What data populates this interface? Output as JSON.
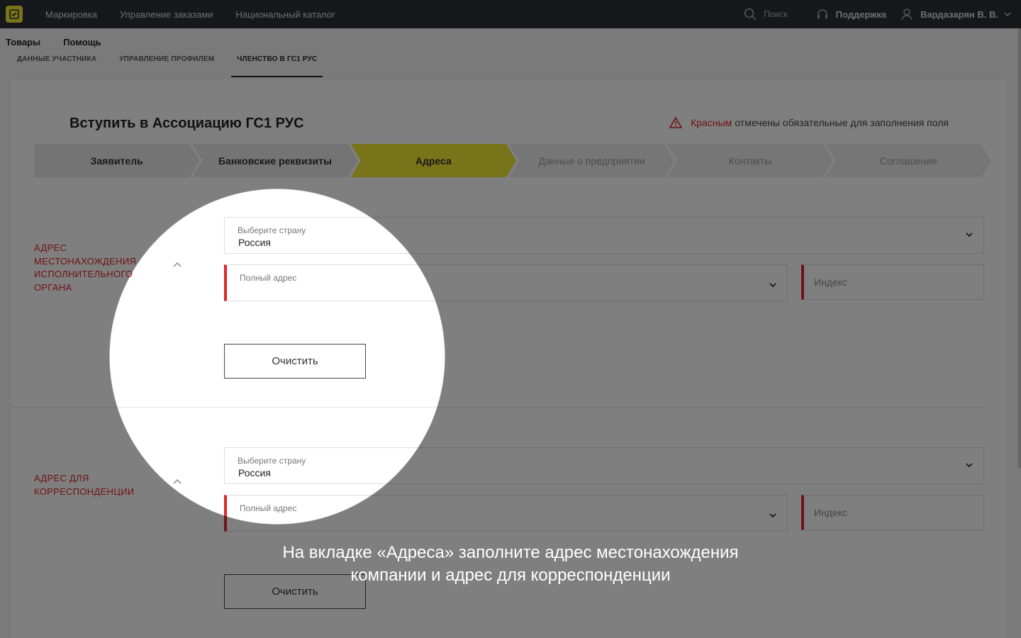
{
  "topbar": {
    "nav": [
      "Маркировка",
      "Управление заказами",
      "Национальный каталог"
    ],
    "search_label": "Поиск",
    "support_label": "Поддержка",
    "user_name": "Вардазарян В. В."
  },
  "subnav": [
    "Товары",
    "Помощь"
  ],
  "tabs": [
    "ДАННЫЕ УЧАСТНИКА",
    "УПРАВЛЕНИЕ ПРОФИЛЕМ",
    "ЧЛЕНСТВО В ГС1 РУС"
  ],
  "page": {
    "title": "Вступить в Ассоциацию ГС1 РУС",
    "required_red": "Красным",
    "required_rest": "отмечены обязательные для заполнения поля"
  },
  "steps": [
    "Заявитель",
    "Банковские реквизиты",
    "Адреса",
    "Данные о предприятии",
    "Контакты",
    "Соглашение"
  ],
  "sections": [
    {
      "label_lines": [
        "АДРЕС",
        "МЕСТОНАХОЖДЕНИЯ",
        "ИСПОЛНИТЕЛЬНОГО",
        "ОРГАНА"
      ],
      "country_label": "Выберите страну",
      "country_value": "Россия",
      "address_label": "Полный адрес",
      "index_placeholder": "Индекс",
      "clear_label": "Очистить"
    },
    {
      "label_lines": [
        "АДРЕС ДЛЯ",
        "КОРРЕСПОНДЕНЦИИ"
      ],
      "country_label": "Выберите страну",
      "country_value": "Россия",
      "address_label": "Полный адрес",
      "index_placeholder": "Индекс",
      "clear_label": "Очистить"
    }
  ],
  "caption_lines": [
    "На вкладке «Адреса» заполните адрес местонахождения",
    "компании и адрес для корреспонденции"
  ],
  "colors": {
    "accent": "#f2e632",
    "required": "#e0252b",
    "topbar": "#2d2f36"
  }
}
